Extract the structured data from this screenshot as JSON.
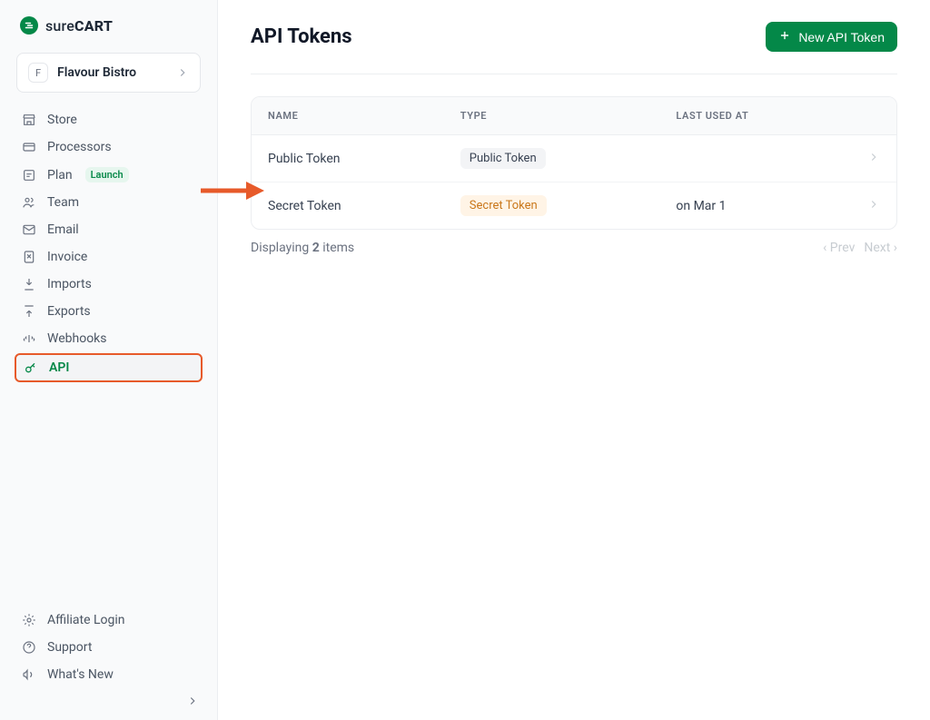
{
  "brand": {
    "prefix": "sure",
    "suffix": "CART"
  },
  "org": {
    "initial": "F",
    "name": "Flavour Bistro"
  },
  "nav": {
    "store": "Store",
    "processors": "Processors",
    "plan": "Plan",
    "plan_badge": "Launch",
    "team": "Team",
    "email": "Email",
    "invoice": "Invoice",
    "imports": "Imports",
    "exports": "Exports",
    "webhooks": "Webhooks",
    "api": "API"
  },
  "bottom": {
    "affiliate": "Affiliate Login",
    "support": "Support",
    "whatsnew": "What's New"
  },
  "page": {
    "title": "API Tokens",
    "new_token_button": "New API Token",
    "columns": {
      "name": "NAME",
      "type": "TYPE",
      "last_used": "LAST USED AT"
    },
    "rows": [
      {
        "name": "Public Token",
        "type_label": "Public Token",
        "type_class": "type-public",
        "last_used": ""
      },
      {
        "name": "Secret Token",
        "type_label": "Secret Token",
        "type_class": "type-secret",
        "last_used": "on Mar 1"
      }
    ],
    "displaying_prefix": "Displaying ",
    "displaying_count": "2",
    "displaying_suffix": " items",
    "prev": "‹ Prev",
    "next": "Next ›"
  }
}
